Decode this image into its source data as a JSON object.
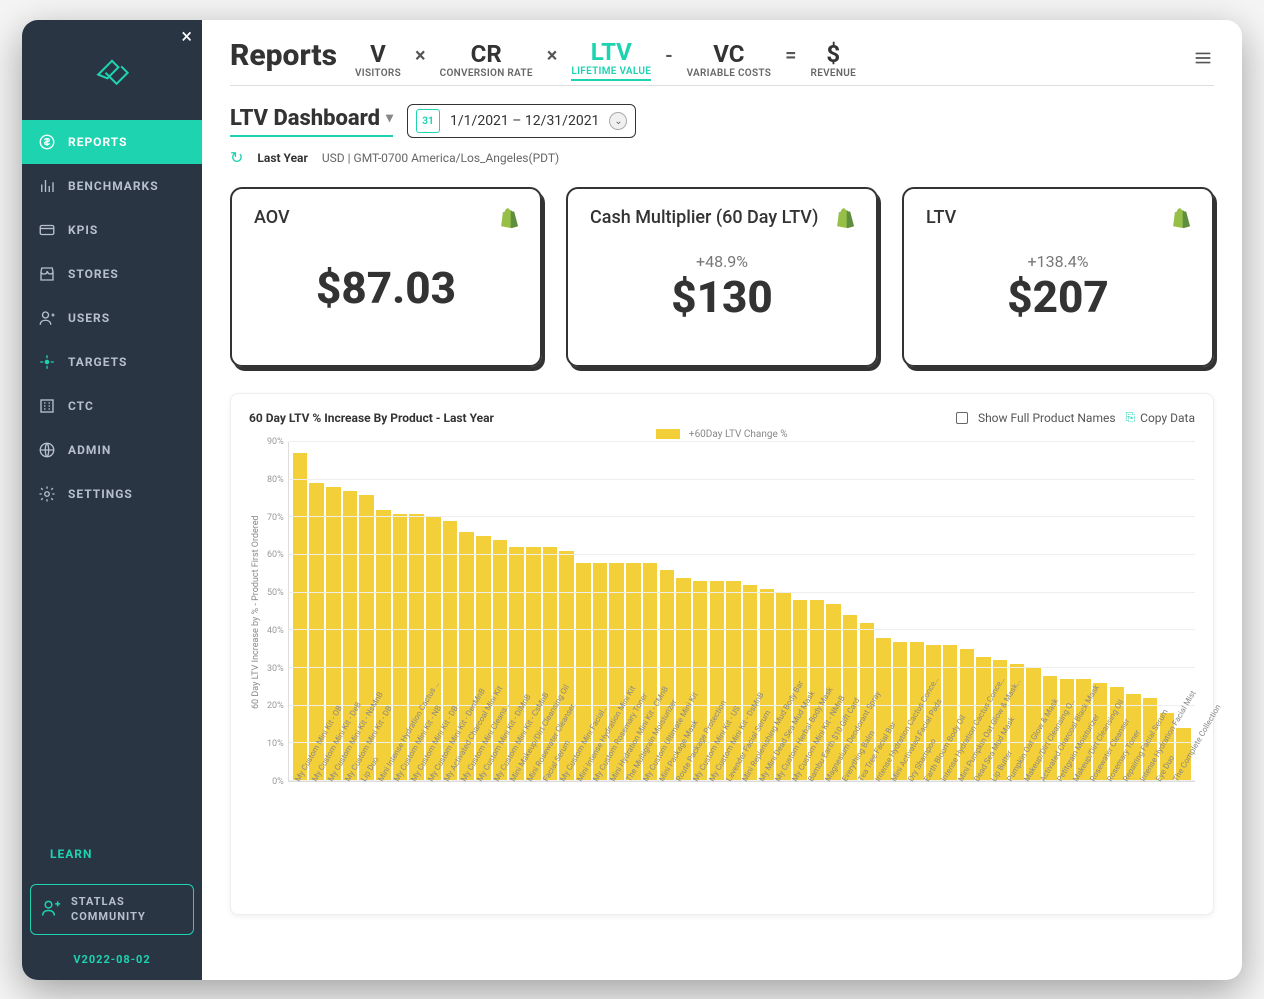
{
  "sidebar": {
    "items": [
      {
        "label": "REPORTS",
        "icon": "dollar-circle-icon",
        "active": true
      },
      {
        "label": "BENCHMARKS",
        "icon": "bar-chart-icon"
      },
      {
        "label": "KPIS",
        "icon": "card-icon"
      },
      {
        "label": "STORES",
        "icon": "store-icon"
      },
      {
        "label": "USERS",
        "icon": "user-plus-icon"
      },
      {
        "label": "TARGETS",
        "icon": "target-icon"
      },
      {
        "label": "CTC",
        "icon": "building-icon"
      },
      {
        "label": "ADMIN",
        "icon": "globe-icon"
      },
      {
        "label": "SETTINGS",
        "icon": "gear-icon"
      }
    ],
    "learn_label": "LEARN",
    "community_line1": "STATLAS",
    "community_line2": "COMMUNITY",
    "version": "V2022-08-02"
  },
  "header": {
    "title": "Reports",
    "terms": [
      {
        "sym": "V",
        "lbl": "VISITORS",
        "op": "×"
      },
      {
        "sym": "CR",
        "lbl": "CONVERSION RATE",
        "op": "×"
      },
      {
        "sym": "LTV",
        "lbl": "LIFETIME VALUE",
        "op": "-",
        "active": true
      },
      {
        "sym": "VC",
        "lbl": "VARIABLE COSTS",
        "op": "="
      },
      {
        "sym": "$",
        "lbl": "REVENUE"
      }
    ]
  },
  "controls": {
    "dashboard_label": "LTV Dashboard",
    "date_range": "1/1/2021 – 12/31/2021",
    "calendar_day": "31",
    "last_year": "Last Year",
    "tz_info": "USD | GMT-0700 America/Los_Angeles(PDT)"
  },
  "cards": [
    {
      "title": "AOV",
      "delta": "",
      "value": "$87.03"
    },
    {
      "title": "Cash Multiplier (60 Day LTV)",
      "delta": "+48.9%",
      "value": "$130"
    },
    {
      "title": "LTV",
      "delta": "+138.4%",
      "value": "$207"
    }
  ],
  "chart": {
    "title": "60 Day LTV % Increase By Product - Last Year",
    "legend": "+60Day LTV Change %",
    "ylabel": "60 Day LTV Increase by % - Product First Ordered",
    "show_full_label": "Show Full Product Names",
    "copy_label": "Copy Data"
  },
  "chart_data": {
    "type": "bar",
    "title": "60 Day LTV % Increase By Product - Last Year",
    "xlabel": "",
    "ylabel": "60 Day LTV Increase by % - Product First Ordered",
    "ylim": [
      0,
      90
    ],
    "yticks": [
      0,
      10,
      20,
      30,
      40,
      50,
      60,
      70,
      80,
      90
    ],
    "series_name": "+60Day LTV Change %",
    "categories": [
      "My Custom Mini Kit - OB",
      "My Custom Mini Kit - DeB",
      "My Custom Mini Kit - NsMnB",
      "My Custom Mini Kit - DB",
      "Lip Duo",
      "Mini Intense Hydration Cactus …",
      "My Custom Mini Kit - NB",
      "My Custom Mini Kit - DB",
      "My Custom Mini Kit - DenMnB",
      "My Activated Charcoal Mini Kit",
      "My Custom Mini Cleans…",
      "My Custom Mini Kit - DiMnB",
      "My Custom Mini Kit - CsMnB",
      "Mini Makeup/Dirt Cleansing Oil",
      "Mini Rosewater Cleanser",
      "Facial Serum",
      "My Custom Mini Facial…",
      "Mini Intense Hydration Mini Kit",
      "My Custom Rosemary Toner",
      "Mini Hydration Mini Kit - CMnB",
      "The Multigrain Moisturizer",
      "My Custom Ultimate Mini Kit",
      "Mini Package Mask",
      "Route Package Protection",
      "My Custom Mini Kit - US",
      "My Custom Mini Kit - DsMnB",
      "Lavender Facial Serum",
      "Mini Replenishing Mud Body Bar",
      "My Mini Dead Sea Mud Mask",
      "My Custom Herbal Body Mask",
      "My Custom Mini Kit - NMnB",
      "Bambu Earth $10 Gift Card",
      "Magnesium Deodorant Spray",
      "Everything Balm",
      "Tea Tree Facial Bar",
      "Intense Hydration Cactus Conce…",
      "Mini Activated Facial Pads",
      "Dry Shampoo",
      "Earth Bloom Body Oil",
      "Intense Hydration Cactus Conce…",
      "Mini Pumpkin Oat Glow & Mask…",
      "Dead Sea Mud Mask",
      "Lip Butter",
      "Pumpkin Oat Glow & Mask",
      "Makeup/Dirt Cleansing O…",
      "Activated Charcoal Black Mask",
      "Petitgrain Moisturizer",
      "Makeup/Dirt Cleansing Oil",
      "Rosewater Cleanser",
      "Rosemary Toner",
      "Repairing Facial Serum",
      "Intense Hydration Facial Mist",
      "Eye Duo",
      "The Complete Collection"
    ],
    "values": [
      87,
      79,
      78,
      77,
      76,
      72,
      71,
      71,
      70,
      69,
      66,
      65,
      64,
      62,
      62,
      62,
      61,
      58,
      58,
      58,
      58,
      58,
      56,
      54,
      53,
      53,
      53,
      52,
      51,
      50,
      48,
      48,
      47,
      44,
      42,
      38,
      37,
      37,
      36,
      36,
      35,
      33,
      32,
      31,
      30,
      28,
      27,
      27,
      26,
      25,
      23,
      22,
      18,
      14
    ]
  }
}
